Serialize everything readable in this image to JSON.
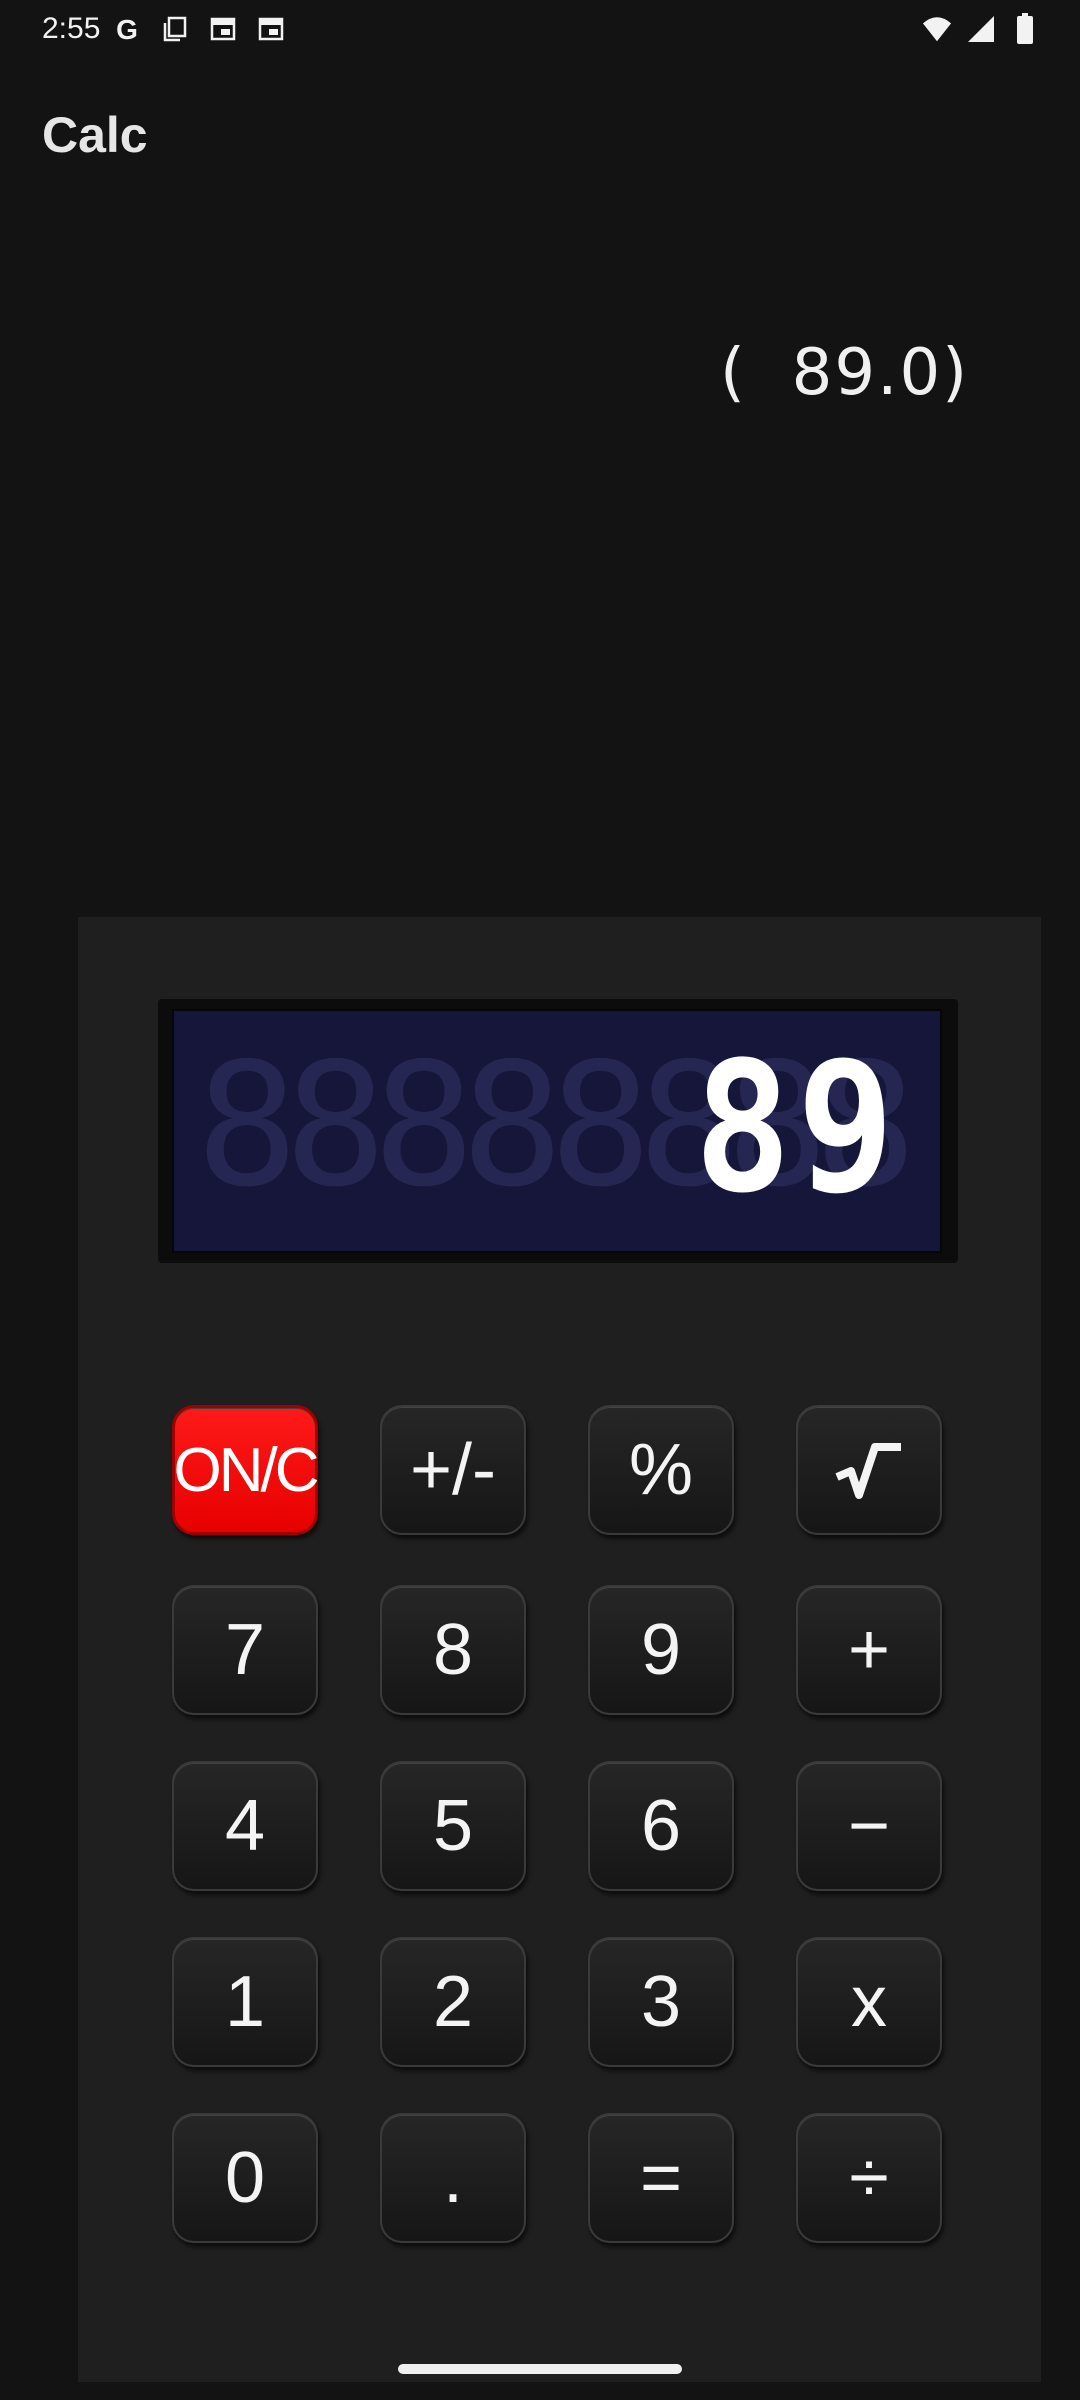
{
  "status_bar": {
    "time": "2:55",
    "left_icons": [
      "google-g-icon",
      "copy-icon",
      "calendar-icon",
      "calendar-icon"
    ],
    "right_icons": [
      "wifi-icon",
      "signal-icon",
      "battery-icon"
    ]
  },
  "app": {
    "title": "Calc"
  },
  "memory": {
    "readout": "(  89.0)"
  },
  "display": {
    "value": "89",
    "ghost_digits": "88888888"
  },
  "keys": {
    "row1": [
      "ON/C",
      "+/-",
      "%",
      "√"
    ],
    "row2": [
      "7",
      "8",
      "9",
      "+"
    ],
    "row3": [
      "4",
      "5",
      "6",
      "−"
    ],
    "row4": [
      "1",
      "2",
      "3",
      "x"
    ],
    "row5": [
      "0",
      ".",
      "=",
      "÷"
    ]
  },
  "colors": {
    "background": "#131314",
    "body": "#1f1f20",
    "lcd": "#16163a",
    "on_key": "#ff0000"
  }
}
